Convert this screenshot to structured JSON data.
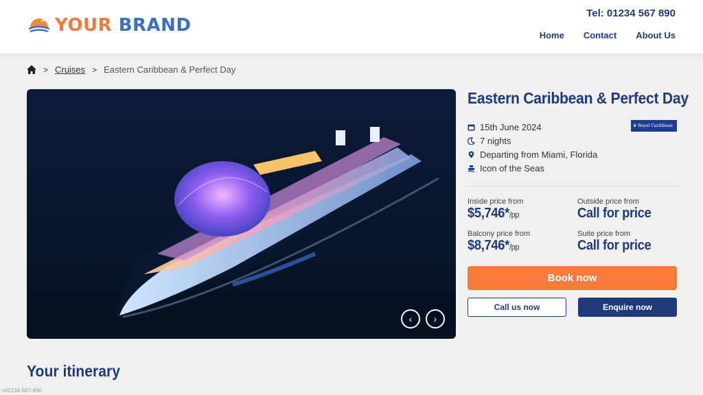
{
  "brand": {
    "your": "YOUR",
    "brand": "BRAND"
  },
  "header": {
    "tel": "Tel: 01234 567 890"
  },
  "nav": {
    "home": "Home",
    "contact": "Contact",
    "about": "About Us"
  },
  "breadcrumb": {
    "sep1": ">",
    "cruises": "Cruises",
    "sep2": ">",
    "current": "Eastern Caribbean & Perfect Day"
  },
  "cruise": {
    "title": "Eastern Caribbean & Perfect Day",
    "date": "15th June 2024",
    "nights": "7 nights",
    "departure": "Departing from Miami, Florida",
    "ship": "Icon of the Seas",
    "line_logo": "Royal Caribbean"
  },
  "prices": {
    "inside_label": "Inside price from",
    "inside_value": "$5,746*",
    "outside_label": "Outside price from",
    "outside_value": "Call for price",
    "balcony_label": "Balcony price from",
    "balcony_value": "$8,746*",
    "suite_label": "Suite price from",
    "suite_value": "Call for price",
    "unit": "/pp"
  },
  "buttons": {
    "book": "Book now",
    "call": "Call us now",
    "enquire": "Enquire now"
  },
  "carousel": {
    "prev": "‹",
    "next": "›"
  },
  "section": {
    "itinerary": "Your itinerary"
  },
  "footer": {
    "tel": "+01234-567-890"
  },
  "colors": {
    "accent": "#fa7a3c",
    "navy": "#1f3a7a"
  },
  "icons": {
    "home": "home-icon",
    "calendar": "calendar-icon",
    "moon": "moon-icon",
    "pin": "map-pin-icon",
    "ship": "ship-icon",
    "prev": "chevron-left-icon",
    "next": "chevron-right-icon"
  }
}
